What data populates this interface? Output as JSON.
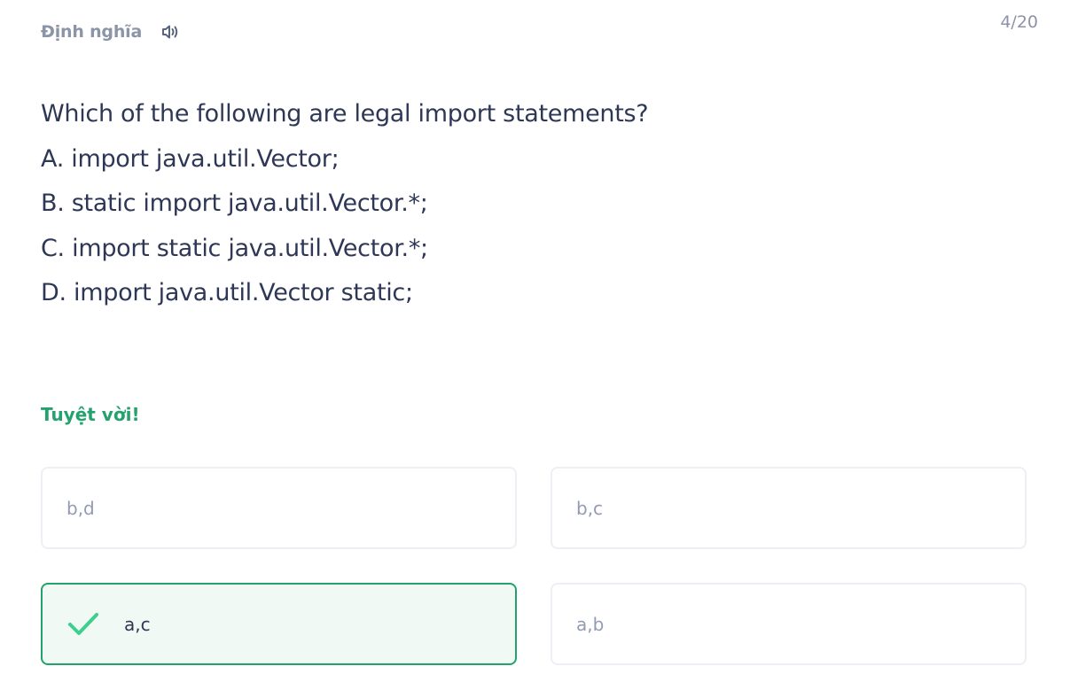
{
  "header": {
    "term_label": "Định nghĩa",
    "audio_icon": "speaker-icon",
    "progress": "4/20"
  },
  "question": {
    "lines": [
      "Which of the following are legal import statements?",
      "A. import java.util.Vector;",
      "B. static import java.util.Vector.*;",
      "C. import static java.util.Vector.*;",
      "D. import java.util.Vector static;"
    ]
  },
  "feedback": {
    "text": "Tuyệt vời!",
    "color": "#23a26d"
  },
  "options": [
    {
      "label": "b,d",
      "state": "default"
    },
    {
      "label": "b,c",
      "state": "default"
    },
    {
      "label": "a,c",
      "state": "correct",
      "icon": "checkmark-icon"
    },
    {
      "label": "a,b",
      "state": "default"
    }
  ],
  "colors": {
    "correct_border": "#23a26d",
    "correct_background": "#f1f9f5",
    "option_border": "#edeff4",
    "muted_text": "#939bb4",
    "primary_text": "#2e3856"
  }
}
